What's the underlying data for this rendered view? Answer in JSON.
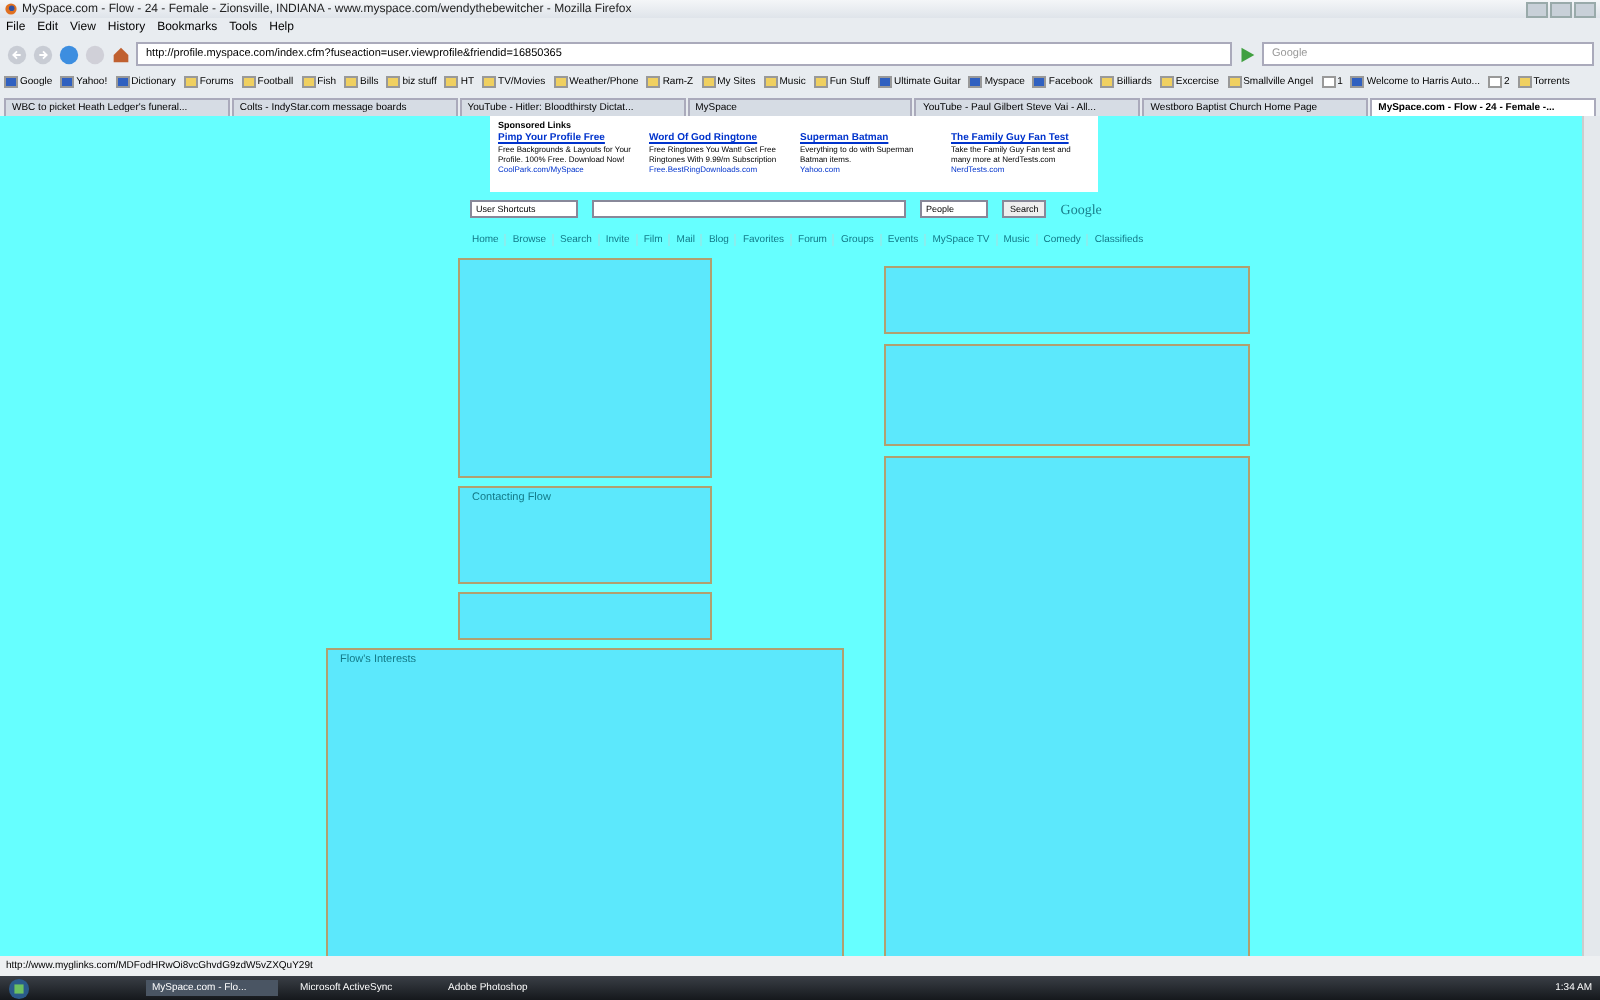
{
  "window": {
    "title": "MySpace.com - Flow - 24 - Female - Zionsville, INDIANA - www.myspace.com/wendythebewitcher - Mozilla Firefox"
  },
  "menu": [
    "File",
    "Edit",
    "View",
    "History",
    "Bookmarks",
    "Tools",
    "Help"
  ],
  "address_bar": {
    "value": "http://profile.myspace.com/index.cfm?fuseaction=user.viewprofile&friendid=16850365"
  },
  "search_bar": {
    "placeholder": "Google"
  },
  "bookmarks": [
    {
      "label": "Google",
      "kind": "site"
    },
    {
      "label": "Yahoo!",
      "kind": "site"
    },
    {
      "label": "Dictionary",
      "kind": "site"
    },
    {
      "label": "Forums",
      "kind": "folder"
    },
    {
      "label": "Football",
      "kind": "folder"
    },
    {
      "label": "Fish",
      "kind": "folder"
    },
    {
      "label": "Bills",
      "kind": "folder"
    },
    {
      "label": "biz stuff",
      "kind": "folder"
    },
    {
      "label": "HT",
      "kind": "folder"
    },
    {
      "label": "TV/Movies",
      "kind": "folder"
    },
    {
      "label": "Weather/Phone",
      "kind": "folder"
    },
    {
      "label": "Ram-Z",
      "kind": "folder"
    },
    {
      "label": "My Sites",
      "kind": "folder"
    },
    {
      "label": "Music",
      "kind": "folder"
    },
    {
      "label": "Fun Stuff",
      "kind": "folder"
    },
    {
      "label": "Ultimate Guitar",
      "kind": "site"
    },
    {
      "label": "Myspace",
      "kind": "site"
    },
    {
      "label": "Facebook",
      "kind": "site"
    },
    {
      "label": "Billiards",
      "kind": "folder"
    },
    {
      "label": "Excercise",
      "kind": "folder"
    },
    {
      "label": "Smallville Angel",
      "kind": "folder"
    },
    {
      "label": "1",
      "kind": "page"
    },
    {
      "label": "Welcome to Harris Auto...",
      "kind": "site"
    },
    {
      "label": "2",
      "kind": "page"
    },
    {
      "label": "Torrents",
      "kind": "folder"
    }
  ],
  "tabs": [
    {
      "label": "WBC to picket Heath Ledger's funeral...",
      "selected": false
    },
    {
      "label": "Colts - IndyStar.com message boards",
      "selected": false
    },
    {
      "label": "YouTube - Hitler: Bloodthirsty Dictat...",
      "selected": false
    },
    {
      "label": "MySpace",
      "selected": false
    },
    {
      "label": "YouTube - Paul Gilbert Steve Vai - All...",
      "selected": false
    },
    {
      "label": "Westboro Baptist Church Home Page",
      "selected": false
    },
    {
      "label": "MySpace.com - Flow - 24 - Female -...",
      "selected": true
    }
  ],
  "sponsored": {
    "title": "Sponsored Links",
    "ads": [
      {
        "title": "Pimp Your Profile Free",
        "text": "Free Backgrounds & Layouts for Your Profile. 100% Free. Download Now!",
        "url": "CoolPark.com/MySpace"
      },
      {
        "title": "Word Of God Ringtone",
        "text": "Free Ringtones You Want! Get Free Ringtones With 9.99/m Subscription",
        "url": "Free.BestRingDownloads.com"
      },
      {
        "title": "Superman Batman",
        "text": "Everything to do with Superman Batman items.",
        "url": "Yahoo.com"
      },
      {
        "title": "The Family Guy Fan Test",
        "text": "Take the Family Guy Fan test and many more at NerdTests.com",
        "url": "NerdTests.com"
      }
    ]
  },
  "site_search": {
    "shortcuts": "User Shortcuts",
    "scope": "People",
    "button": "Search",
    "powered": "Google"
  },
  "site_nav": [
    "Home",
    "Browse",
    "Search",
    "Invite",
    "Film",
    "Mail",
    "Blog",
    "Favorites",
    "Forum",
    "Groups",
    "Events",
    "MySpace TV",
    "Music",
    "Comedy",
    "Classifieds"
  ],
  "panels": {
    "contact": "Contacting Flow",
    "interests": "Flow's Interests"
  },
  "status_bar": {
    "text": "http://www.myglinks.com/MDFodHRwOi8vcGhvdG9zdW5vZXQuY29t"
  },
  "taskbar": {
    "items": [
      {
        "label": "MySpace.com - Flo...",
        "selected": true
      },
      {
        "label": "Microsoft ActiveSync",
        "selected": false
      },
      {
        "label": "Adobe Photoshop",
        "selected": false
      }
    ],
    "clock": "1:34 AM"
  }
}
